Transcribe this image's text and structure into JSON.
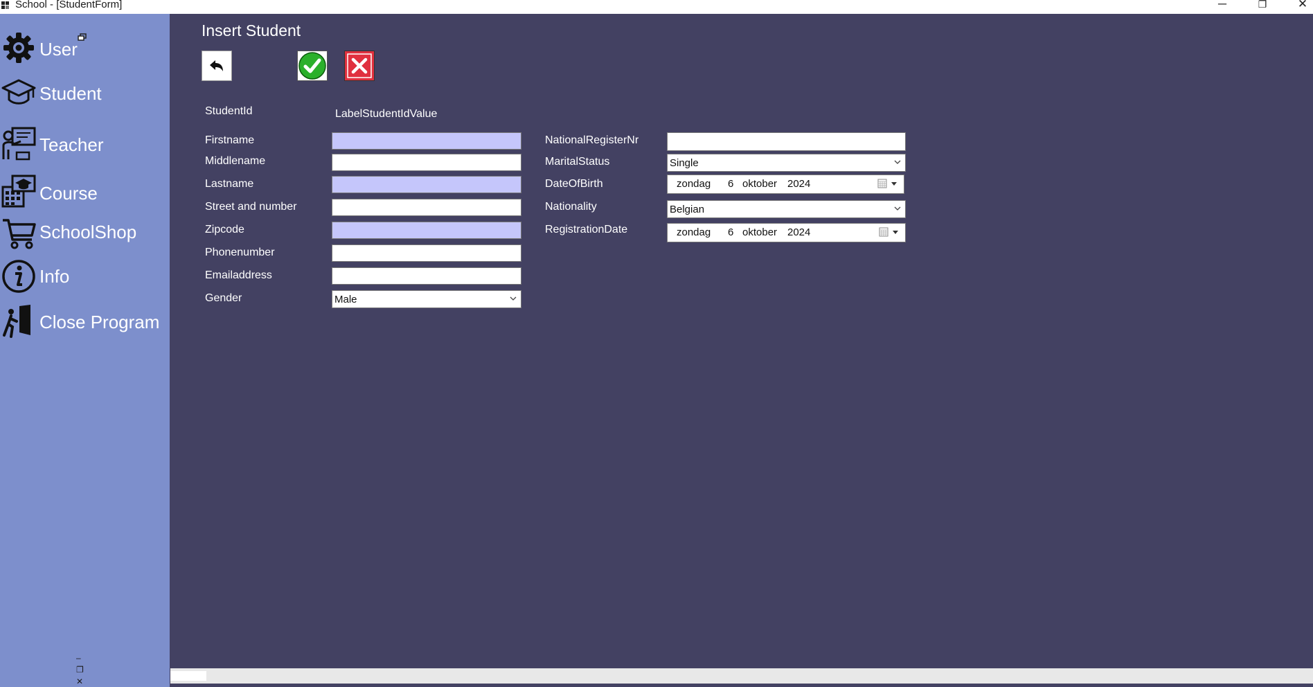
{
  "window": {
    "title": "School - [StudentForm]",
    "minimize_glyph": "─",
    "restore_glyph": "❐",
    "close_glyph": "✕"
  },
  "sidebar": {
    "items": [
      {
        "label": "User",
        "icon": "gear-icon"
      },
      {
        "label": "Student",
        "icon": "graduation-cap-icon"
      },
      {
        "label": "Teacher",
        "icon": "teacher-icon"
      },
      {
        "label": "Course",
        "icon": "course-calendar-icon"
      },
      {
        "label": "SchoolShop",
        "icon": "shopping-cart-icon"
      },
      {
        "label": "Info",
        "icon": "info-icon"
      },
      {
        "label": "Close Program",
        "icon": "exit-door-icon"
      }
    ],
    "mdi_minimize": "‒",
    "mdi_restore": "❐",
    "mdi_close": "✕"
  },
  "form": {
    "title": "Insert Student",
    "toolbar": [
      "back-icon",
      "confirm-check-icon",
      "cancel-x-icon"
    ],
    "student_id_label": "StudentId",
    "student_id_value": "LabelStudentIdValue",
    "left_fields": {
      "firstname": {
        "label": "Firstname",
        "value": ""
      },
      "middlename": {
        "label": "Middlename",
        "value": ""
      },
      "lastname": {
        "label": "Lastname",
        "value": ""
      },
      "street": {
        "label": "Street and number",
        "value": ""
      },
      "zipcode": {
        "label": "Zipcode",
        "value": ""
      },
      "phone": {
        "label": "Phonenumber",
        "value": ""
      },
      "email": {
        "label": "Emailaddress",
        "value": ""
      },
      "gender": {
        "label": "Gender",
        "value": "Male"
      }
    },
    "right_fields": {
      "national_register": {
        "label": "NationalRegisterNr",
        "value": ""
      },
      "marital_status": {
        "label": "MaritalStatus",
        "value": "Single"
      },
      "date_of_birth": {
        "label": "DateOfBirth",
        "day_name": "zondag",
        "day": "6",
        "month": "oktober",
        "year": "2024"
      },
      "nationality": {
        "label": "Nationality",
        "value": "Belgian"
      },
      "registration_date": {
        "label": "RegistrationDate",
        "day_name": "zondag",
        "day": "6",
        "month": "oktober",
        "year": "2024"
      }
    }
  },
  "colors": {
    "sidebar": "#7d8fcc",
    "main_background": "#434162",
    "required_field": "#c5c6fb",
    "confirm_green": "#2bb02b",
    "cancel_red": "#e0303f"
  }
}
